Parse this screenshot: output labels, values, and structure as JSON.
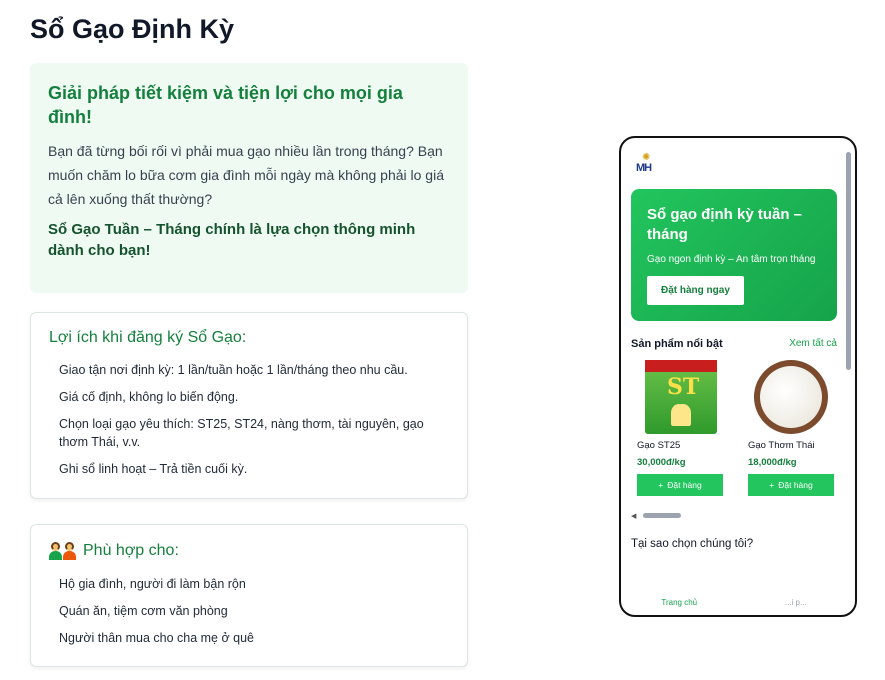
{
  "page": {
    "title": "Sổ Gạo Định Kỳ"
  },
  "hero": {
    "heading": "Giải pháp tiết kiệm và tiện lợi cho mọi gia đình!",
    "text": "Bạn đã từng bối rối vì phải mua gạo nhiều lần trong tháng? Bạn muốn chăm lo bữa cơm gia đình mỗi ngày mà không phải lo giá cả lên xuống thất thường?",
    "cta": "Sổ Gạo Tuần – Tháng chính là lựa chọn thông minh dành cho bạn!"
  },
  "benefits": {
    "heading": "Lợi ích khi đăng ký Sổ Gạo:",
    "items": [
      "Giao tận nơi định kỳ: 1 lần/tuần hoặc 1 lần/tháng theo nhu cầu.",
      "Giá cố định, không lo biến động.",
      "Chọn loại gạo yêu thích: ST25, ST24, nàng thơm, tài nguyên, gạo thơm Thái, v.v.",
      "Ghi sổ linh hoạt – Trả tiền cuối kỳ."
    ]
  },
  "fit": {
    "icon": "people-icon",
    "heading": "Phù hợp cho:",
    "items": [
      "Hộ gia đình, người đi làm bận rộn",
      "Quán ăn, tiệm cơm văn phòng",
      "Người thân mua cho cha mẹ ở quê"
    ]
  },
  "phone": {
    "logo_text": "MH",
    "banner": {
      "title": "Sổ gạo định kỳ tuần – tháng",
      "subtitle": "Gạo ngon định kỳ – An tâm trọn tháng",
      "button": "Đặt hàng ngay"
    },
    "featured": {
      "label": "Sản phẩm nổi bật",
      "see_all": "Xem tất cả"
    },
    "products": [
      {
        "name": "Gạo ST25",
        "price": "30,000đ/kg",
        "button": "Đặt hàng",
        "bag_text": "ST"
      },
      {
        "name": "Gạo Thơm Thái",
        "price": "18,000đ/kg",
        "button": "Đặt hàng"
      }
    ],
    "why_heading": "Tại sao chọn chúng tôi?",
    "nav": {
      "home": "Trang chủ",
      "second": "...i p..."
    }
  },
  "colors": {
    "accent": "#16a34a",
    "hero_bg": "#effbf2",
    "heading_green": "#15803d"
  }
}
